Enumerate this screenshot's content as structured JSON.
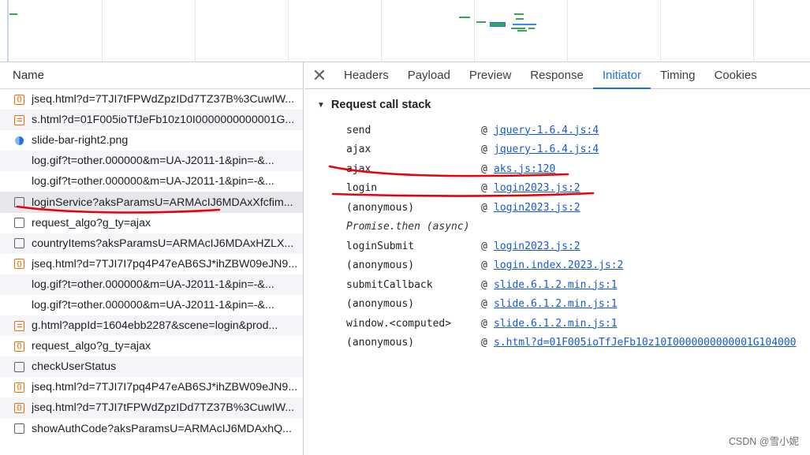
{
  "list": {
    "header": "Name",
    "rows": [
      {
        "name": "jseq.html?d=7TJI7tFPWdZpzIDd7TZ37B%3CuwIW...",
        "icon": "script-icon",
        "kind": "script"
      },
      {
        "name": "s.html?d=01F005ioTfJeFb10z10I0000000000001G...",
        "icon": "document-icon",
        "kind": "doc"
      },
      {
        "name": "slide-bar-right2.png",
        "icon": "image-icon",
        "kind": "img"
      },
      {
        "name": "log.gif?t=other.000000&m=UA-J2011-1&pin=-&...",
        "icon": "",
        "kind": "none"
      },
      {
        "name": "log.gif?t=other.000000&m=UA-J2011-1&pin=-&...",
        "icon": "",
        "kind": "none"
      },
      {
        "name": "loginService?aksParamsU=ARMAcIJ6MDAxXfcfim...",
        "icon": "file-icon",
        "kind": "blank"
      },
      {
        "name": "request_algo?g_ty=ajax",
        "icon": "file-icon",
        "kind": "blank"
      },
      {
        "name": "countryItems?aksParamsU=ARMAcIJ6MDAxHZLX...",
        "icon": "file-icon",
        "kind": "blank"
      },
      {
        "name": "jseq.html?d=7TJI7I7pq4P47eAB6SJ*ihZBW09eJN9...",
        "icon": "script-icon",
        "kind": "script"
      },
      {
        "name": "log.gif?t=other.000000&m=UA-J2011-1&pin=-&...",
        "icon": "",
        "kind": "none"
      },
      {
        "name": "log.gif?t=other.000000&m=UA-J2011-1&pin=-&...",
        "icon": "",
        "kind": "none"
      },
      {
        "name": "g.html?appId=1604ebb2287&scene=login&prod...",
        "icon": "document-icon",
        "kind": "doc"
      },
      {
        "name": "request_algo?g_ty=ajax",
        "icon": "script-icon",
        "kind": "script"
      },
      {
        "name": "checkUserStatus",
        "icon": "file-icon",
        "kind": "blank"
      },
      {
        "name": "jseq.html?d=7TJI7I7pq4P47eAB6SJ*ihZBW09eJN9...",
        "icon": "script-icon",
        "kind": "script"
      },
      {
        "name": "jseq.html?d=7TJI7tFPWdZpzIDd7TZ37B%3CuwIW...",
        "icon": "script-icon",
        "kind": "script"
      },
      {
        "name": "showAuthCode?aksParamsU=ARMAcIJ6MDAxhQ...",
        "icon": "file-icon",
        "kind": "blank"
      }
    ]
  },
  "tabs": {
    "close_glyph": "✕",
    "items": [
      "Headers",
      "Payload",
      "Preview",
      "Response",
      "Initiator",
      "Timing",
      "Cookies"
    ],
    "active": "Initiator"
  },
  "callstack": {
    "title": "Request call stack",
    "frames": [
      {
        "fn": "send",
        "at": "@",
        "loc": "jquery-1.6.4.js:4"
      },
      {
        "fn": "ajax",
        "at": "@",
        "loc": "jquery-1.6.4.js:4"
      },
      {
        "fn": "ajax",
        "at": "@",
        "loc": "aks.js:120"
      },
      {
        "fn": "login",
        "at": "@",
        "loc": "login2023.js:2"
      },
      {
        "fn": "(anonymous)",
        "at": "@",
        "loc": "login2023.js:2"
      },
      {
        "fn": "Promise.then (async)",
        "at": "",
        "loc": "",
        "async": true
      },
      {
        "fn": "loginSubmit",
        "at": "@",
        "loc": "login2023.js:2"
      },
      {
        "fn": "(anonymous)",
        "at": "@",
        "loc": "login.index.2023.js:2"
      },
      {
        "fn": "submitCallback",
        "at": "@",
        "loc": "slide.6.1.2.min.js:1"
      },
      {
        "fn": "(anonymous)",
        "at": "@",
        "loc": "slide.6.1.2.min.js:1"
      },
      {
        "fn": "window.<computed>",
        "at": "@",
        "loc": "slide.6.1.2.min.js:1"
      },
      {
        "fn": "(anonymous)",
        "at": "@",
        "loc": "s.html?d=01F005ioTfJeFb10z10I0000000000001G104000"
      }
    ]
  },
  "watermark": "CSDN @雪小妮",
  "colors": {
    "accent": "#1a73e8",
    "annotation": "#e8000b",
    "script_icon": "#e8710a"
  }
}
